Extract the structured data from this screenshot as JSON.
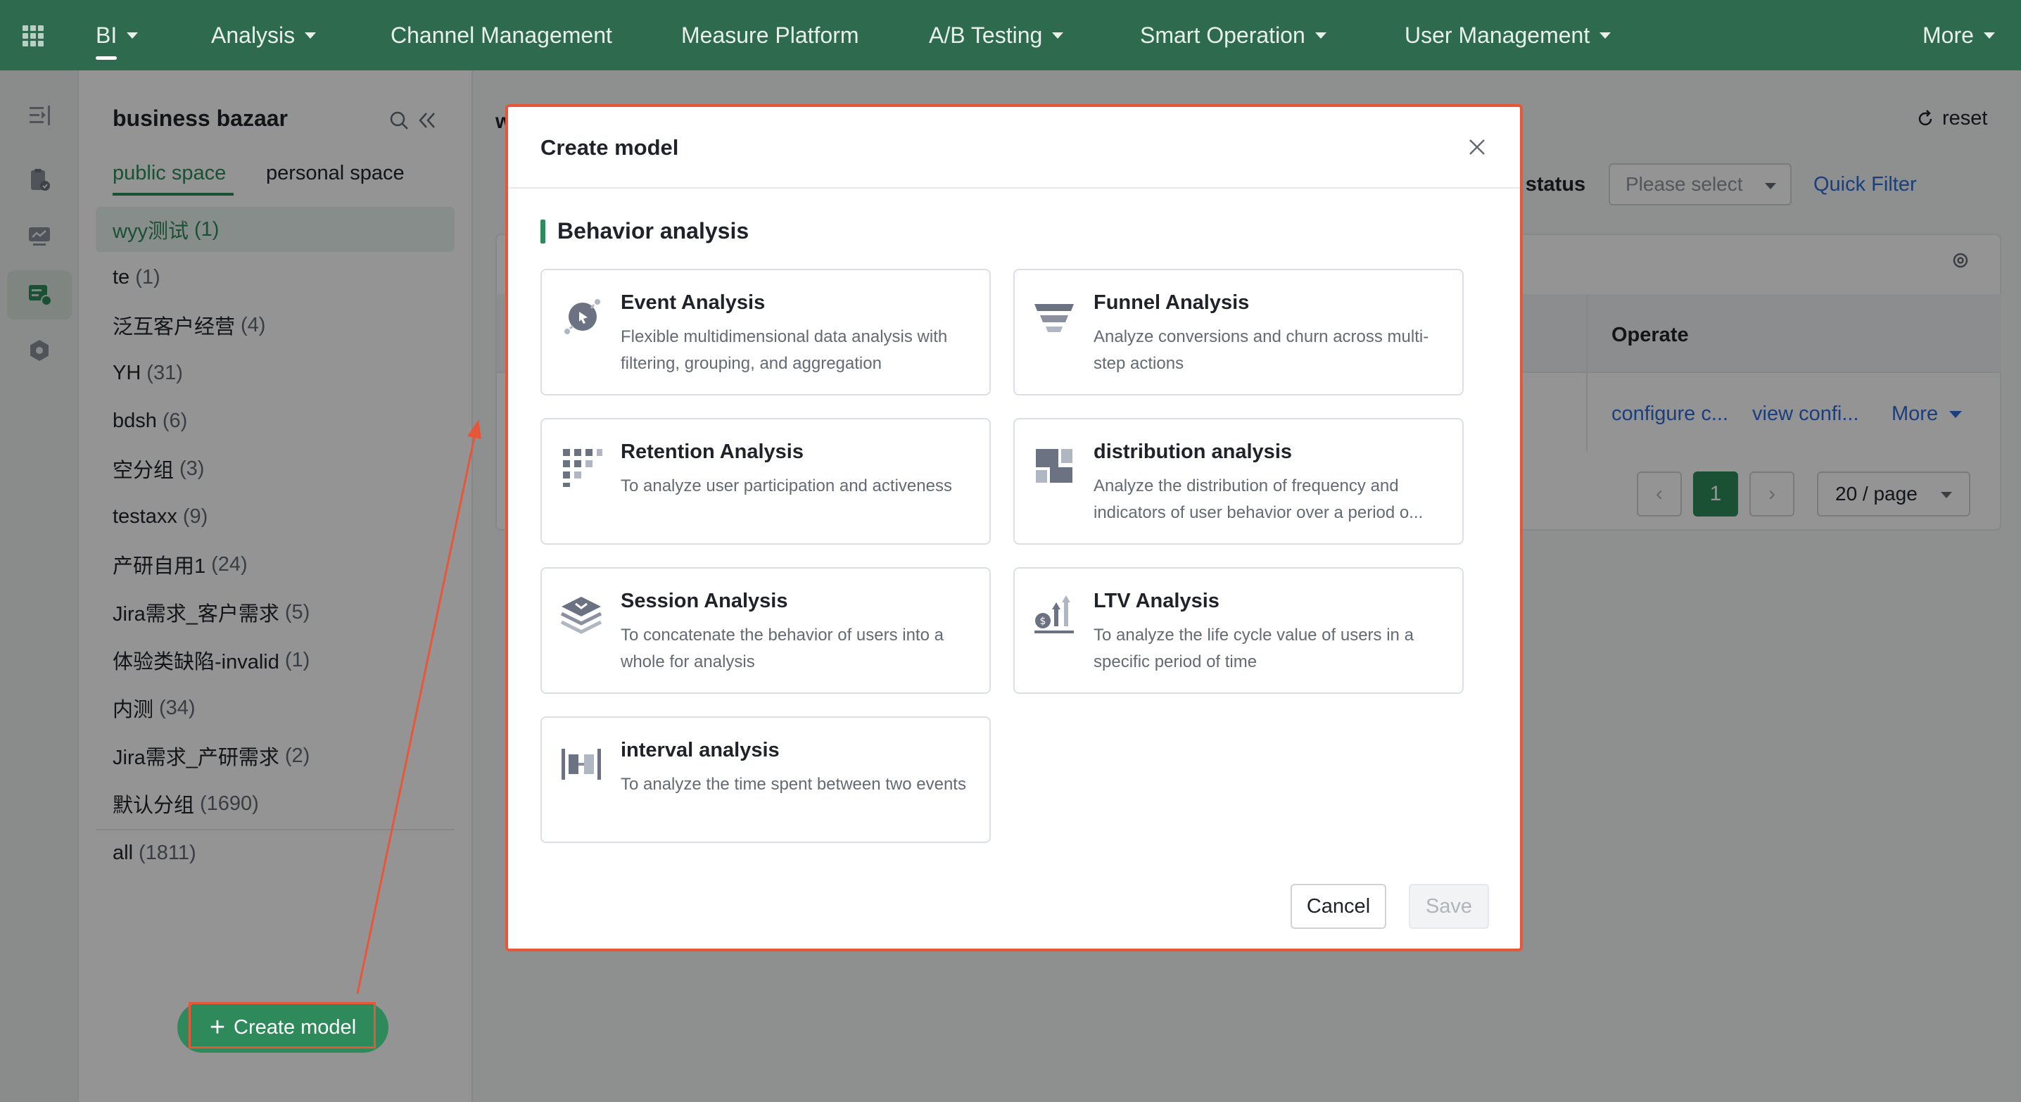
{
  "topnav": {
    "items": [
      {
        "label": "BI",
        "has_caret": true,
        "active": true
      },
      {
        "label": "Analysis",
        "has_caret": true
      },
      {
        "label": "Channel Management",
        "has_caret": false
      },
      {
        "label": "Measure Platform",
        "has_caret": false
      },
      {
        "label": "A/B Testing",
        "has_caret": true
      },
      {
        "label": "Smart Operation",
        "has_caret": true
      },
      {
        "label": "User Management",
        "has_caret": true
      },
      {
        "label": "More",
        "has_caret": true
      }
    ],
    "bg_color": "#2e6a4d"
  },
  "rail": {
    "icons": [
      "collapse-menu-icon",
      "report-icon",
      "dashboard-icon",
      "model-icon",
      "settings-hex-icon"
    ]
  },
  "sidebar": {
    "title": "business bazaar",
    "tabs": {
      "public": "public space",
      "personal": "personal space"
    },
    "items": [
      {
        "name": "wyy测试",
        "count": "(1)",
        "active": true
      },
      {
        "name": "te",
        "count": "(1)"
      },
      {
        "name": "泛互客户经营",
        "count": "(4)"
      },
      {
        "name": "YH",
        "count": "(31)"
      },
      {
        "name": "bdsh",
        "count": "(6)"
      },
      {
        "name": "空分组",
        "count": "(3)"
      },
      {
        "name": "testaxx",
        "count": "(9)"
      },
      {
        "name": "产研自用1",
        "count": "(24)"
      },
      {
        "name": "Jira需求_客户需求",
        "count": "(5)"
      },
      {
        "name": "体验类缺陷-invalid",
        "count": "(1)"
      },
      {
        "name": "内测",
        "count": "(34)"
      },
      {
        "name": "Jira需求_产研需求",
        "count": "(2)"
      },
      {
        "name": "默认分组",
        "count": "(1690)"
      }
    ],
    "all": {
      "name": "all",
      "count": "(1811)"
    },
    "create_button": "Create model"
  },
  "main": {
    "heading_fragment": "w",
    "reset": "reset",
    "filter_label": "g status",
    "select_placeholder": "Please select",
    "quick_filter": "Quick Filter",
    "operate_header": "Operate",
    "row_ops": [
      "configure c...",
      "view confi...",
      "More"
    ],
    "pagination": {
      "current": "1",
      "prev": "‹",
      "next": "›",
      "page_size": "20 / page"
    }
  },
  "modal": {
    "title": "Create model",
    "section": "Behavior analysis",
    "cards": [
      {
        "title": "Event Analysis",
        "desc": "Flexible multidimensional data analysis with filtering, grouping, and aggregation",
        "icon": "event-analysis-icon"
      },
      {
        "title": "Funnel Analysis",
        "desc": "Analyze conversions and churn across multi-step actions",
        "icon": "funnel-icon"
      },
      {
        "title": "Retention Analysis",
        "desc": "To analyze user participation and activeness",
        "icon": "retention-icon"
      },
      {
        "title": "distribution analysis",
        "desc": "Analyze the distribution of frequency and indicators of user behavior over a period o...",
        "icon": "distribution-icon"
      },
      {
        "title": "Session Analysis",
        "desc": "To concatenate the behavior of users into a whole for analysis",
        "icon": "session-icon"
      },
      {
        "title": "LTV Analysis",
        "desc": "To analyze the life cycle value of users in a specific period of time",
        "icon": "ltv-icon"
      },
      {
        "title": "interval analysis",
        "desc": "To analyze the time spent between two events",
        "icon": "interval-icon"
      }
    ],
    "cancel": "Cancel",
    "save": "Save"
  },
  "colors": {
    "accent": "#2e8a5a",
    "highlight": "#e8563a",
    "link": "#2f6bd6"
  }
}
